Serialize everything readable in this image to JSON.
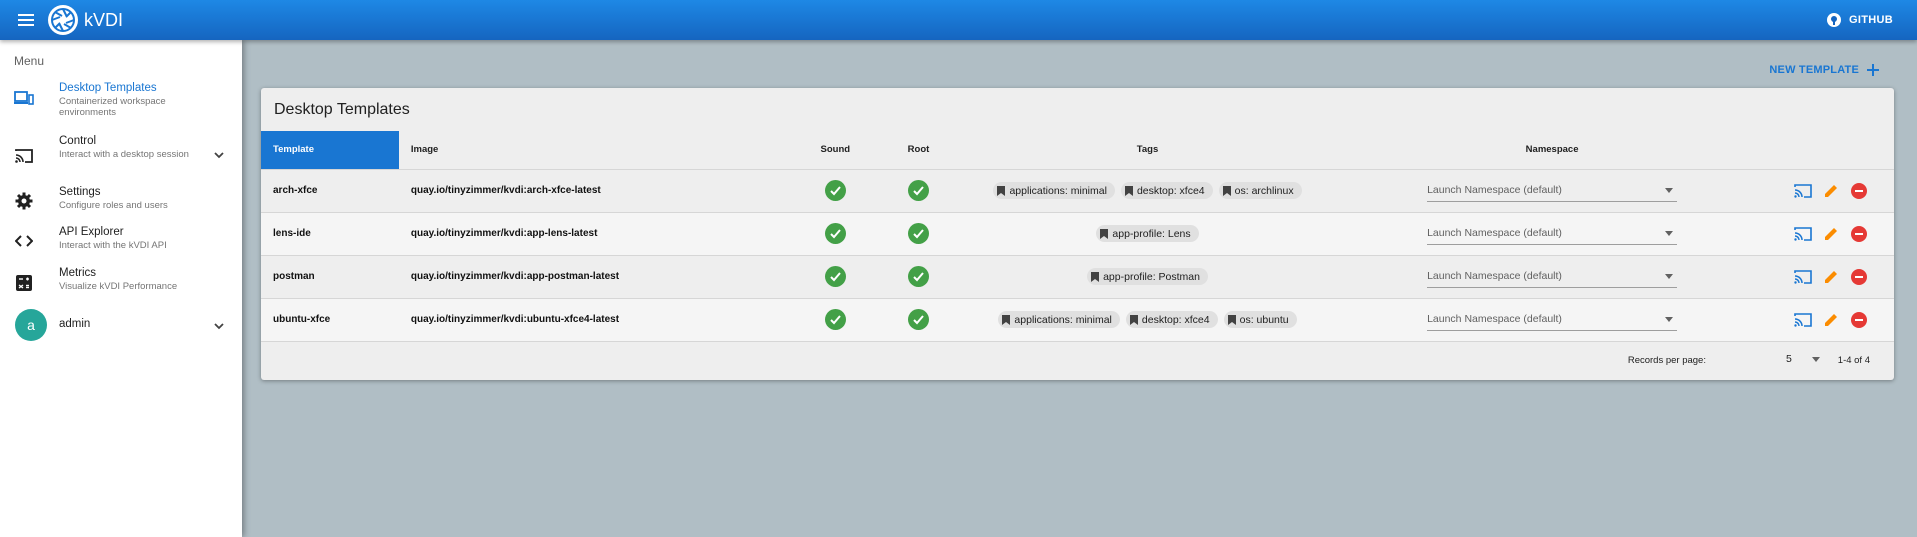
{
  "app": {
    "title": "kVDI",
    "github_label": "GITHUB"
  },
  "sidebar": {
    "menu_label": "Menu",
    "items": [
      {
        "title": "Desktop Templates",
        "subtitle": "Containerized workspace environments",
        "icon": "desktop-icon",
        "active": true
      },
      {
        "title": "Control",
        "subtitle": "Interact with a desktop session",
        "icon": "cast-icon",
        "expandable": true
      },
      {
        "title": "Settings",
        "subtitle": "Configure roles and users",
        "icon": "gear-icon"
      },
      {
        "title": "API Explorer",
        "subtitle": "Interact with the kVDI API",
        "icon": "code-icon"
      },
      {
        "title": "Metrics",
        "subtitle": "Visualize kVDI Performance",
        "icon": "calculator-icon"
      }
    ],
    "user": {
      "initial": "a",
      "name": "admin"
    }
  },
  "main": {
    "new_template_label": "NEW TEMPLATE",
    "card_title": "Desktop Templates",
    "columns": [
      "Template",
      "Image",
      "Sound",
      "Root",
      "Tags",
      "Namespace"
    ],
    "rows": [
      {
        "template": "arch-xfce",
        "image": "quay.io/tinyzimmer/kvdi:arch-xfce-latest",
        "sound": true,
        "root": true,
        "tags": [
          "applications: minimal",
          "desktop: xfce4",
          "os: archlinux"
        ],
        "namespace": "Launch Namespace (default)"
      },
      {
        "template": "lens-ide",
        "image": "quay.io/tinyzimmer/kvdi:app-lens-latest",
        "sound": true,
        "root": true,
        "tags": [
          "app-profile: Lens"
        ],
        "namespace": "Launch Namespace (default)"
      },
      {
        "template": "postman",
        "image": "quay.io/tinyzimmer/kvdi:app-postman-latest",
        "sound": true,
        "root": true,
        "tags": [
          "app-profile: Postman"
        ],
        "namespace": "Launch Namespace (default)"
      },
      {
        "template": "ubuntu-xfce",
        "image": "quay.io/tinyzimmer/kvdi:ubuntu-xfce4-latest",
        "sound": true,
        "root": true,
        "tags": [
          "applications: minimal",
          "desktop: xfce4",
          "os: ubuntu"
        ],
        "namespace": "Launch Namespace (default)"
      }
    ],
    "footer": {
      "records_label": "Records per page:",
      "records_value": "5",
      "pagination": "1-4 of 4"
    }
  },
  "colors": {
    "primary": "#1976d2",
    "success": "#43a047",
    "warning": "#fb8c00",
    "danger": "#e53935",
    "background": "#b0bec5"
  }
}
